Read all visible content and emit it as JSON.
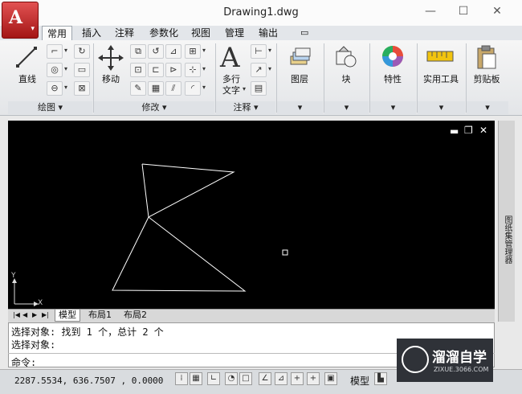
{
  "window": {
    "title": "Drawing1.dwg",
    "minimize": "—",
    "maximize": "☐",
    "close": "✕"
  },
  "app_button": {
    "letter": "A",
    "dropdown": "▾"
  },
  "tabs": [
    "常用",
    "插入",
    "注释",
    "参数化",
    "视图",
    "管理",
    "输出"
  ],
  "tab_extra": "▭",
  "ribbon": {
    "draw_panel": {
      "title": "绘图 ▾",
      "line_label": "直线"
    },
    "modify_panel": {
      "title": "修改 ▾",
      "move_label": "移动"
    },
    "annotation_panel": {
      "title": "注释 ▾",
      "mtext_label_1": "多行",
      "mtext_label_2": "文字"
    },
    "layers_label": "图层",
    "block_label": "块",
    "properties_label": "特性",
    "utilities_label": "实用工具",
    "clipboard_label": "剪贴板",
    "panel_arrow": "▾"
  },
  "viewport_controls": {
    "minimize": "▬",
    "restore": "❐",
    "close": "✕"
  },
  "ucs": {
    "x": "X",
    "y": "Y"
  },
  "layout_tabs": {
    "nav": [
      "|◀",
      "◀",
      "▶",
      "▶|"
    ],
    "items": [
      "模型",
      "布局1",
      "布局2"
    ]
  },
  "right_panel_label": "图纸集管理器",
  "command": {
    "history": [
      "选择对象: 找到 1 个，总计 2 个",
      "选择对象:"
    ],
    "prompt": "命令:"
  },
  "status": {
    "coordinates": "2287.5534, 636.7507 , 0.0000",
    "model_label": "模型"
  },
  "watermark": {
    "name": "溜溜自学",
    "url": "ZIXUE.3066.COM"
  },
  "colors": {
    "drawing_background": "#000000",
    "geometry": "#ffffff",
    "app_red": "#c0282b"
  }
}
